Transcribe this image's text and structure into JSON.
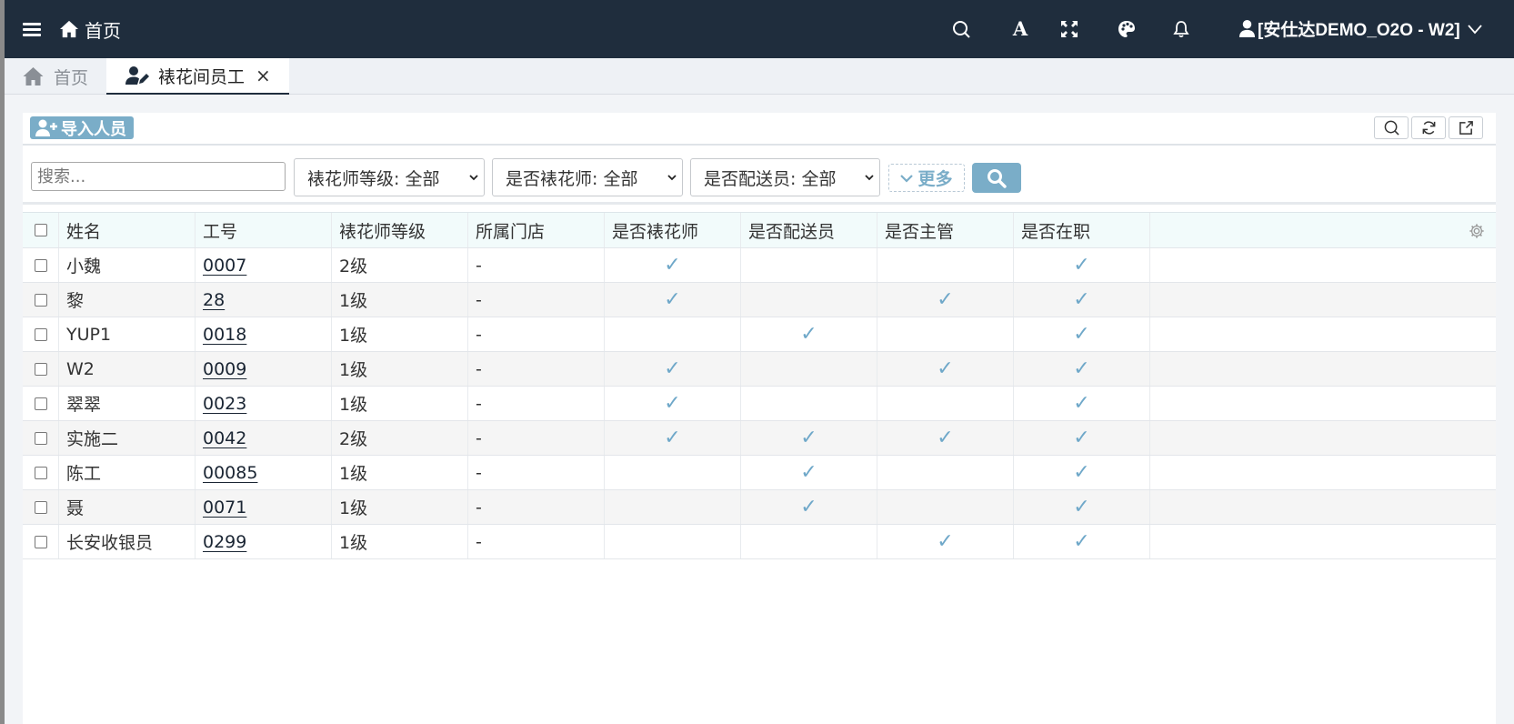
{
  "header": {
    "brand_label": "首页",
    "font_icon_glyph": "A",
    "user_label": "[安仕达DEMO_O2O - W2]",
    "icons": [
      "menu-icon",
      "home-icon",
      "search-icon",
      "font-icon",
      "expand-icon",
      "palette-icon",
      "bell-icon",
      "user-icon",
      "chevron-down-icon"
    ]
  },
  "tabs": {
    "home_label": "首页",
    "active_label": "裱花间员工",
    "close_glyph": "×"
  },
  "toolbar": {
    "import_label": "导入人员"
  },
  "filters": {
    "search_placeholder": "搜索...",
    "grade_select": "裱花师等级: 全部",
    "florist_select": "是否裱花师: 全部",
    "delivery_select": "是否配送员: 全部",
    "more_label": "更多"
  },
  "table": {
    "columns": {
      "name": "姓名",
      "no": "工号",
      "grade": "裱花师等级",
      "store": "所属门店",
      "florist": "是否裱花师",
      "delivery": "是否配送员",
      "manager": "是否主管",
      "active": "是否在职"
    },
    "tick_glyph": "✓",
    "rows": [
      {
        "name": "小魏",
        "no": "0007",
        "grade": "2级",
        "store": "-",
        "florist": true,
        "delivery": false,
        "manager": false,
        "active": true
      },
      {
        "name": "黎",
        "no": "28",
        "grade": "1级",
        "store": "-",
        "florist": true,
        "delivery": false,
        "manager": true,
        "active": true
      },
      {
        "name": "YUP1",
        "no": "0018",
        "grade": "1级",
        "store": "-",
        "florist": false,
        "delivery": true,
        "manager": false,
        "active": true
      },
      {
        "name": "W2",
        "no": "0009",
        "grade": "1级",
        "store": "-",
        "florist": true,
        "delivery": false,
        "manager": true,
        "active": true
      },
      {
        "name": "翠翠",
        "no": "0023",
        "grade": "1级",
        "store": "-",
        "florist": true,
        "delivery": false,
        "manager": false,
        "active": true
      },
      {
        "name": "实施二",
        "no": "0042",
        "grade": "2级",
        "store": "-",
        "florist": true,
        "delivery": true,
        "manager": true,
        "active": true
      },
      {
        "name": "陈工",
        "no": "00085",
        "grade": "1级",
        "store": "-",
        "florist": false,
        "delivery": true,
        "manager": false,
        "active": true
      },
      {
        "name": "聂",
        "no": "0071",
        "grade": "1级",
        "store": "-",
        "florist": false,
        "delivery": true,
        "manager": false,
        "active": true
      },
      {
        "name": "长安收银员",
        "no": "0299",
        "grade": "1级",
        "store": "-",
        "florist": false,
        "delivery": false,
        "manager": true,
        "active": true
      }
    ]
  },
  "colors": {
    "topbar": "#1f2d3d",
    "accent": "#7aadc8",
    "tick": "#6fa8c9"
  }
}
